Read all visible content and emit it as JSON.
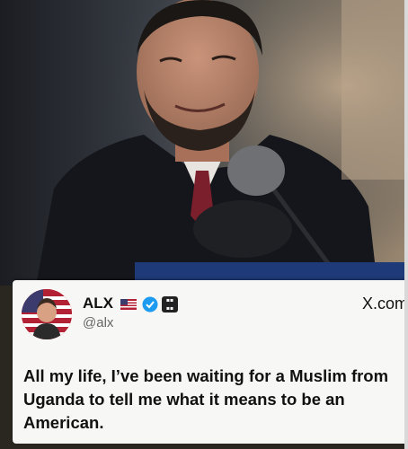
{
  "tweet": {
    "display_name": "ALX",
    "handle": "@alx",
    "site": "X.com",
    "text": "All my life, I’ve been waiting for a Muslim from Uganda to tell me what it means to be an American."
  },
  "colors": {
    "verified": "#1d9bf0",
    "card_bg": "#f7f7f5",
    "text": "#111111",
    "handle": "#666666"
  },
  "icons": [
    "us-flag-icon",
    "verified-badge-icon",
    "affiliate-badge-icon",
    "x-logo"
  ]
}
